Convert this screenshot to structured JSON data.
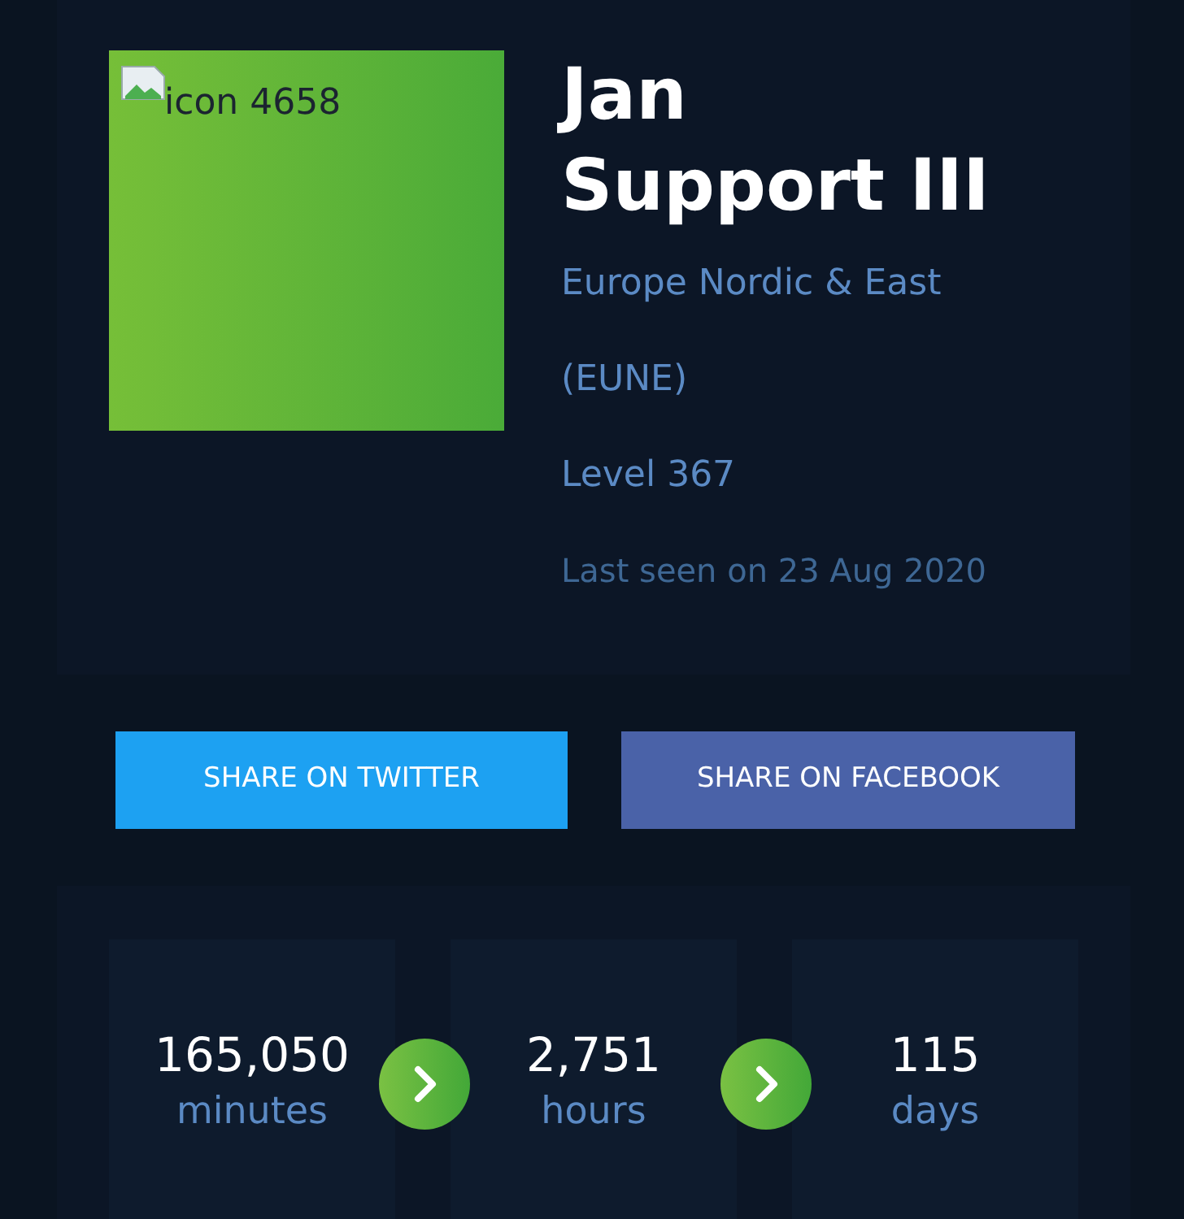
{
  "profile": {
    "avatar_alt": "icon 4658",
    "name_lines": [
      "Jan",
      "Support III"
    ],
    "region_lines": [
      "Europe Nordic & East",
      "(EUNE)"
    ],
    "level": "Level 367",
    "last_seen": "Last seen on 23 Aug 2020"
  },
  "share_buttons": [
    {
      "kind": "twitter",
      "label": "SHARE ON TWITTER"
    },
    {
      "kind": "facebook",
      "label": "SHARE ON FACEBOOK"
    }
  ],
  "stats": [
    {
      "value": "165,050",
      "unit": "minutes"
    },
    {
      "value": "2,751",
      "unit": "hours"
    },
    {
      "value": "115",
      "unit": "days"
    }
  ]
}
